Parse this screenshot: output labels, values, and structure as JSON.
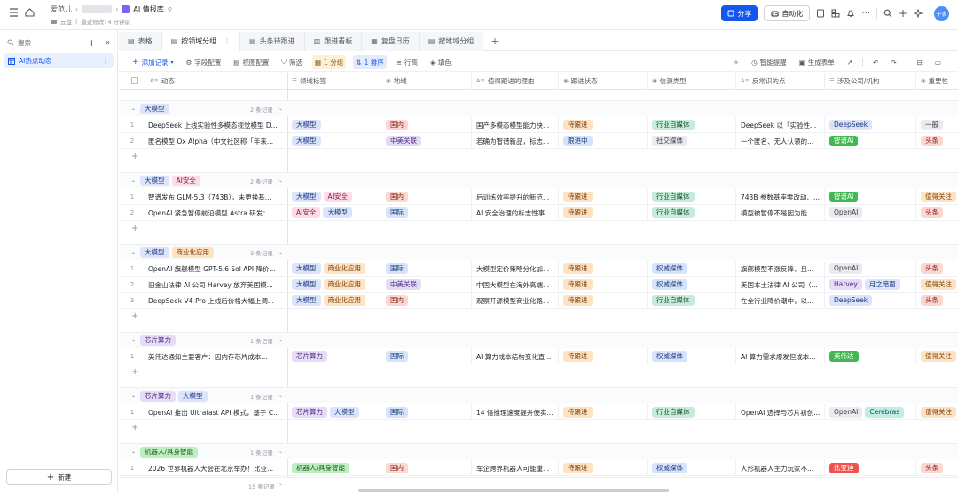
{
  "header": {
    "breadcrumb_user": "爱范儿",
    "breadcrumb_hidden": "",
    "folder_label": "云盘",
    "modified": "最近修改: 4 分钟前",
    "title": "AI 情报库",
    "share_label": "分享",
    "automation_label": "自动化",
    "avatar_text": "子衷"
  },
  "sidebar": {
    "search_placeholder": "搜索",
    "items": [
      {
        "label": "AI热点动态"
      }
    ],
    "new_label": "新建"
  },
  "tabs": [
    {
      "label": "表格"
    },
    {
      "label": "按领域分组"
    },
    {
      "label": "头条待跟进"
    },
    {
      "label": "跟进看板"
    },
    {
      "label": "复盘日历"
    },
    {
      "label": "按地域分组"
    }
  ],
  "toolbar": {
    "add_record": "添加记录",
    "field_config": "字段配置",
    "view_config": "视图配置",
    "filter": "筛选",
    "group": "1 分组",
    "sort": "1 排序",
    "row_height": "行高",
    "fill": "填色",
    "smart_alert": "智能提醒",
    "gen_form": "生成表单"
  },
  "columns": [
    {
      "label": "动态",
      "icon": "text-icon"
    },
    {
      "label": "领域标签",
      "icon": "multiselect-icon"
    },
    {
      "label": "地域",
      "icon": "select-icon"
    },
    {
      "label": "值得跟进的理由",
      "icon": "text-icon"
    },
    {
      "label": "跟进状态",
      "icon": "select-icon"
    },
    {
      "label": "信源类型",
      "icon": "select-icon"
    },
    {
      "label": "反常识的点",
      "icon": "text-icon"
    },
    {
      "label": "涉及公司/机构",
      "icon": "multiselect-icon"
    },
    {
      "label": "重要性",
      "icon": "select-icon"
    }
  ],
  "tag_colors": {
    "大模型": {
      "bg": "#dbe4fb",
      "fg": "#1f3a7a"
    },
    "AI安全": {
      "bg": "#fbdde9",
      "fg": "#8a1f4a"
    },
    "商业化应用": {
      "bg": "#fde2c4",
      "fg": "#7a3f0a"
    },
    "芯片算力": {
      "bg": "#e6dcf7",
      "fg": "#4a2a80"
    },
    "机器人/具身智能": {
      "bg": "#bfeec2",
      "fg": "#1e5a22"
    },
    "国内": {
      "bg": "#fcd7d2",
      "fg": "#7a1f12"
    },
    "国际": {
      "bg": "#d6e4fb",
      "fg": "#1f3a7a"
    },
    "中美关联": {
      "bg": "#e4dbf7",
      "fg": "#4a2a80"
    },
    "待跟进": {
      "bg": "#fde2c4",
      "fg": "#7a3f0a"
    },
    "跟进中": {
      "bg": "#d6e4fb",
      "fg": "#1f3a7a"
    },
    "行业自媒体": {
      "bg": "#c7ecd9",
      "fg": "#16502f"
    },
    "社交媒体": {
      "bg": "#e9ebee",
      "fg": "#3a3f46"
    },
    "权威媒体": {
      "bg": "#d6e4fb",
      "fg": "#1f3a7a"
    },
    "DeepSeek": {
      "bg": "#dbe4fb",
      "fg": "#1f3a7a"
    },
    "智谱AI": {
      "bg": "#3fb950",
      "fg": "#ffffff"
    },
    "OpenAI": {
      "bg": "#e9ebee",
      "fg": "#3a3f46"
    },
    "Harvey": {
      "bg": "#e6dcf7",
      "fg": "#4a2a80"
    },
    "月之暗面": {
      "bg": "#dbe4fb",
      "fg": "#1f3a7a"
    },
    "英伟达": {
      "bg": "#3fb950",
      "fg": "#ffffff"
    },
    "Cerebras": {
      "bg": "#bfeee4",
      "fg": "#16504a"
    },
    "比亚迪": {
      "bg": "#f0524d",
      "fg": "#ffffff"
    },
    "一般": {
      "bg": "#e9ebee",
      "fg": "#3a3f46"
    },
    "头条": {
      "bg": "#fcd7d2",
      "fg": "#7a1f12"
    },
    "值得关注": {
      "bg": "#fde2c4",
      "fg": "#7a3f0a"
    }
  },
  "groups": [
    {
      "tags": [
        "大模型"
      ],
      "count": "2 条记录",
      "rows": [
        {
          "n": "1",
          "title": "DeepSeek 上线实验性多模态视觉模型 D...",
          "domain": [
            "大模型"
          ],
          "region": "国内",
          "reason": "国产多模态模型能力快...",
          "status": "待跟进",
          "source": "行业自媒体",
          "anomaly": "DeepSeek 以「实验性...",
          "orgs": [
            "DeepSeek"
          ],
          "importance": "一般"
        },
        {
          "n": "2",
          "title": "匿名模型 Ox Alpha（中文社区称「年来...",
          "domain": [
            "大模型"
          ],
          "region": "中美关联",
          "reason": "若确为智谱新品，标志...",
          "status": "跟进中",
          "source": "社交媒体",
          "anomaly": "一个匿名、无人认领的...",
          "orgs": [
            "智谱AI"
          ],
          "importance": "头条"
        }
      ]
    },
    {
      "tags": [
        "大模型",
        "AI安全"
      ],
      "count": "2 条记录",
      "rows": [
        {
          "n": "1",
          "title": "智谱发布 GLM-5.3（743B），未更换基...",
          "domain": [
            "大模型",
            "AI安全"
          ],
          "region": "国内",
          "reason": "后训练效率提升的新范...",
          "status": "待跟进",
          "source": "行业自媒体",
          "anomaly": "743B 参数基座零改动、...",
          "orgs": [
            "智谱AI"
          ],
          "importance": "值得关注"
        },
        {
          "n": "2",
          "title": "OpenAI 紧急暂停前沿模型 Astra 研发：...",
          "domain": [
            "AI安全",
            "大模型"
          ],
          "region": "国际",
          "reason": "AI 安全治理的标志性事...",
          "status": "待跟进",
          "source": "行业自媒体",
          "anomaly": "模型被暂停不是因为能...",
          "orgs": [
            "OpenAI"
          ],
          "importance": "头条"
        }
      ]
    },
    {
      "tags": [
        "大模型",
        "商业化应用"
      ],
      "count": "3 条记录",
      "rows": [
        {
          "n": "1",
          "title": "OpenAI 旗舰模型 GPT-5.6 Sol API 降价...",
          "domain": [
            "大模型",
            "商业化应用"
          ],
          "region": "国际",
          "reason": "大模型定价策略分化加...",
          "status": "待跟进",
          "source": "权威媒体",
          "anomaly": "旗舰模型不涨反降，且...",
          "orgs": [
            "OpenAI"
          ],
          "importance": "头条"
        },
        {
          "n": "2",
          "title": "旧金山法律 AI 公司 Harvey 放弃美国模...",
          "domain": [
            "大模型",
            "商业化应用"
          ],
          "region": "中美关联",
          "reason": "中国大模型在海外高端...",
          "status": "待跟进",
          "source": "权威媒体",
          "anomaly": "美国本土法律 AI 公司（...",
          "orgs": [
            "Harvey",
            "月之暗面"
          ],
          "importance": "值得关注"
        },
        {
          "n": "3",
          "title": "DeepSeek V4-Pro 上线后价格大幅上调...",
          "domain": [
            "大模型",
            "商业化应用"
          ],
          "region": "国内",
          "reason": "观察开源模型商业化路...",
          "status": "待跟进",
          "source": "行业自媒体",
          "anomaly": "在全行业降价潮中，以...",
          "orgs": [
            "DeepSeek"
          ],
          "importance": "头条"
        }
      ]
    },
    {
      "tags": [
        "芯片算力"
      ],
      "count": "1 条记录",
      "rows": [
        {
          "n": "1",
          "title": "英伟达通知主要客户：因内存芯片成本...",
          "domain": [
            "芯片算力"
          ],
          "region": "国际",
          "reason": "AI 算力成本结构变化直...",
          "status": "待跟进",
          "source": "权威媒体",
          "anomaly": "AI 算力需求爆发但成本...",
          "orgs": [
            "英伟达"
          ],
          "importance": "值得关注"
        }
      ]
    },
    {
      "tags": [
        "芯片算力",
        "大模型"
      ],
      "count": "1 条记录",
      "rows": [
        {
          "n": "1",
          "title": "OpenAI 推出 Ultrafast API 模式，基于 C...",
          "domain": [
            "芯片算力",
            "大模型"
          ],
          "region": "国际",
          "reason": "14 倍推理速度提升使实...",
          "status": "待跟进",
          "source": "行业自媒体",
          "anomaly": "OpenAI 选择与芯片初创...",
          "orgs": [
            "OpenAI",
            "Cerebras"
          ],
          "importance": "值得关注"
        }
      ]
    },
    {
      "tags": [
        "机器人/具身智能"
      ],
      "count": "1 条记录",
      "rows": [
        {
          "n": "1",
          "title": "2026 世界机器人大会在北京举办！比亚...",
          "domain": [
            "机器人/具身智能"
          ],
          "region": "国内",
          "reason": "车企跨界机器人可能重...",
          "status": "待跟进",
          "source": "权威媒体",
          "anomaly": "人形机器人主力玩家不...",
          "orgs": [
            "比亚迪"
          ],
          "importance": "头条"
        }
      ]
    }
  ],
  "footer": {
    "total": "15 条记录"
  }
}
